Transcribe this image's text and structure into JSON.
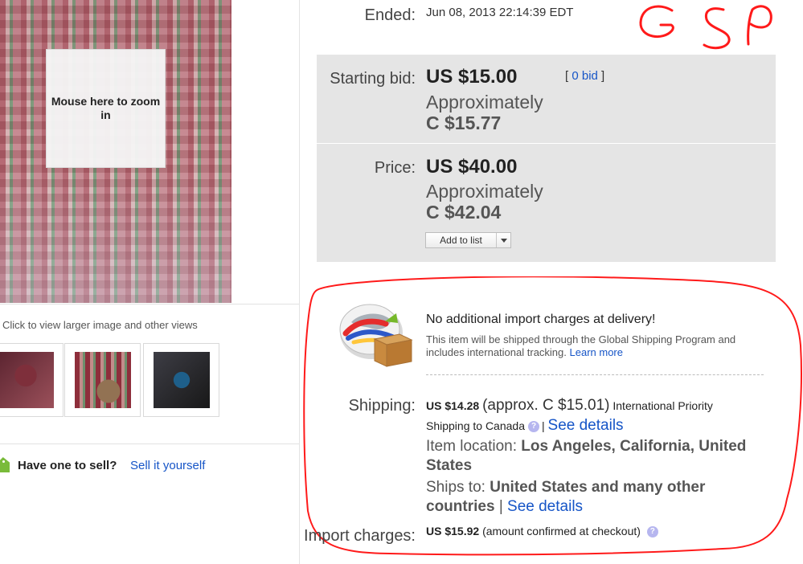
{
  "left_panel": {
    "zoom_label": "Mouse here to zoom in",
    "thumbnails_caption": "Click to view larger image and other views",
    "have_one_text": "Have one to sell?",
    "sell_link": "Sell it yourself"
  },
  "listing": {
    "ended_label": "Ended:",
    "ended_value": "Jun 08, 2013  22:14:39 EDT",
    "starting_bid_label": "Starting bid:",
    "starting_bid_value": "US $15.00",
    "bid_count_prefix": "[ ",
    "bid_count_link": "0 bid",
    "bid_count_suffix": " ]",
    "approximately_1": "Approximately",
    "approx_value_1": "C $15.77",
    "price_label": "Price:",
    "price_value": "US $40.00",
    "approximately_2": "Approximately",
    "approx_value_2": "C $42.04",
    "add_to_list": "Add to list"
  },
  "handwriting": {
    "annotation": "GSP",
    "color": "#ff1a1a"
  },
  "shipping": {
    "gsp_title": "No additional import charges at delivery!",
    "gsp_desc": "This item will be shipped through the Global Shipping Program and includes international tracking.",
    "learn_more": "Learn more",
    "shipping_label": "Shipping:",
    "shipping_cost": "US $14.28",
    "shipping_approx": "(approx. C $15.01)",
    "shipping_service": "International Priority",
    "shipping_destination": "Shipping to Canada",
    "help_icon_text": "?",
    "separator": "|",
    "see_details_1": "See details",
    "item_location_label": "Item location:",
    "item_location_value": "Los Angeles, California, United States",
    "ships_to_label": "Ships to:",
    "ships_to_value": "United States and many other countries",
    "separator_2": "|",
    "see_details_2": "See details",
    "import_label": "Import charges:",
    "import_value": "US $15.92",
    "import_note": "(amount confirmed at checkout)"
  }
}
